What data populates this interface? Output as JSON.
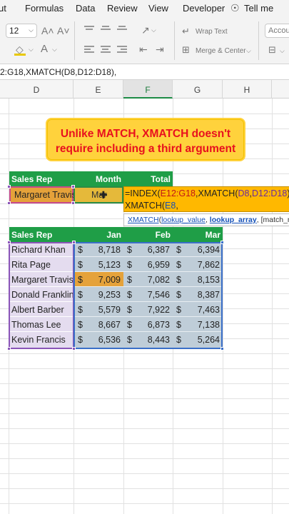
{
  "menu": {
    "items": [
      "ut",
      "Formulas",
      "Data",
      "Review",
      "View",
      "Developer",
      "Tell me"
    ]
  },
  "ribbon": {
    "font_size": "12",
    "wrap_text": "Wrap Text",
    "merge_center": "Merge & Center",
    "format_box": "Accou"
  },
  "formula_bar": {
    "text": "2:G18,XMATCH(D8,D12:D18),"
  },
  "columns": [
    "D",
    "E",
    "F",
    "G",
    "H"
  ],
  "callout": {
    "line1": "Unlike MATCH, XMATCH doesn't",
    "line2": "require including a third argument"
  },
  "lookup": {
    "headers": [
      "Sales Rep",
      "Month",
      "Total"
    ],
    "name": "Margaret Travis",
    "month": "Mar",
    "formula_parts": [
      "=INDEX(",
      "E12:G18",
      ",XMATCH(",
      "D8",
      ",",
      "D12:D18",
      "),",
      "XMATCH(",
      "E8",
      ","
    ],
    "tooltip": {
      "fn": "XMATCH",
      "open": "(",
      "arg1": "lookup_value",
      "sep1": ", ",
      "arg2": "lookup_array",
      "rest": ", [match_mo"
    }
  },
  "table": {
    "headers": [
      "Sales Rep",
      "Jan",
      "Feb",
      "Mar"
    ],
    "currency": "$",
    "rows": [
      {
        "name": "Richard Khan",
        "jan": "8,718",
        "feb": "6,387",
        "mar": "6,394"
      },
      {
        "name": "Rita Page",
        "jan": "5,123",
        "feb": "6,959",
        "mar": "7,862"
      },
      {
        "name": "Margaret Travis",
        "jan": "7,009",
        "feb": "7,082",
        "mar": "8,153"
      },
      {
        "name": "Donald Franklin",
        "jan": "9,253",
        "feb": "7,546",
        "mar": "8,387"
      },
      {
        "name": "Albert Barber",
        "jan": "5,579",
        "feb": "7,922",
        "mar": "7,463"
      },
      {
        "name": "Thomas Lee",
        "jan": "8,667",
        "feb": "6,873",
        "mar": "7,138"
      },
      {
        "name": "Kevin Francis",
        "jan": "6,536",
        "feb": "8,443",
        "mar": "5,264"
      }
    ]
  },
  "colors": {
    "header_green": "#1f9e47",
    "callout_yellow": "#ffd23c",
    "callout_text_red": "#e8101e",
    "edit_cell_orange": "#ffb800"
  }
}
